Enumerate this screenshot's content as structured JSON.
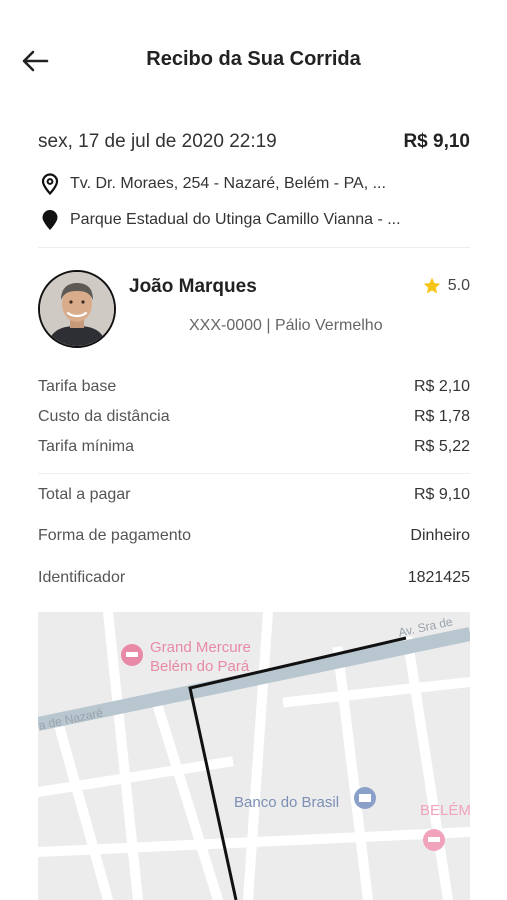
{
  "header": {
    "title": "Recibo da Sua Corrida"
  },
  "trip": {
    "datetime": "sex, 17 de jul de 2020 22:19",
    "total": "R$ 9,10",
    "origin": "Tv. Dr. Moraes, 254 - Nazaré, Belém - PA, ...",
    "destination": "Parque Estadual do Utinga Camillo Vianna - ..."
  },
  "driver": {
    "name": "João Marques",
    "rating": "5.0",
    "vehicle": "XXX-0000 | Pálio Vermelho"
  },
  "fares": {
    "base_label": "Tarifa base",
    "base_value": "R$ 2,10",
    "distance_label": "Custo da distância",
    "distance_value": "R$ 1,78",
    "minimum_label": "Tarifa mínima",
    "minimum_value": "R$ 5,22",
    "total_label": "Total a pagar",
    "total_value": "R$ 9,10",
    "payment_label": "Forma de pagamento",
    "payment_value": "Dinheiro",
    "id_label": "Identificador",
    "id_value": "1821425"
  },
  "map": {
    "hotel_line1": "Grand Mercure",
    "hotel_line2": "Belém do Pará",
    "bank": "Banco do Brasil",
    "belem": "BELÉM",
    "street_top": "Av. Sra de",
    "street_left": "a de Nazaré"
  },
  "colors": {
    "star": "#f5c518",
    "route": "#111111",
    "main_road": "#b7c6cf",
    "map_bg": "#ececec"
  },
  "icons": {
    "back": "arrow-left-icon",
    "origin": "location-outline-icon",
    "destination": "location-filled-icon",
    "rating": "star-icon",
    "hotel": "hotel-pin-icon",
    "bank": "bank-pin-icon"
  }
}
